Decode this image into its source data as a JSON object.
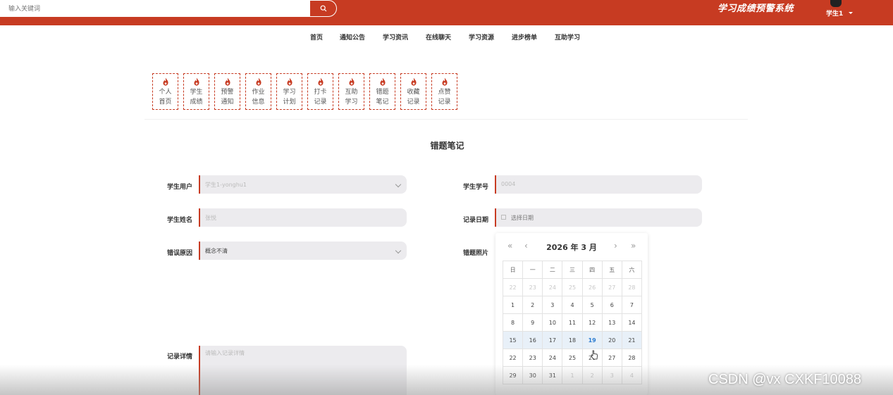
{
  "search": {
    "placeholder": "输入关键词"
  },
  "site_title": "学习成绩预警系统",
  "user": {
    "name": "学生1"
  },
  "nav": [
    "首页",
    "通知公告",
    "学习资讯",
    "在线聊天",
    "学习资源",
    "进步榜单",
    "互助学习"
  ],
  "tiles": [
    [
      "个人",
      "首页"
    ],
    [
      "学生",
      "成绩"
    ],
    [
      "预警",
      "通知"
    ],
    [
      "作业",
      "信息"
    ],
    [
      "学习",
      "计划"
    ],
    [
      "打卡",
      "记录"
    ],
    [
      "互助",
      "学习"
    ],
    [
      "错题",
      "笔记"
    ],
    [
      "收藏",
      "记录"
    ],
    [
      "点赞",
      "记录"
    ]
  ],
  "page_title": "错题笔记",
  "form": {
    "student_user": {
      "label": "学生用户",
      "value": "学生1-yonghu1"
    },
    "student_no": {
      "label": "学生学号",
      "value": "0004"
    },
    "student_name": {
      "label": "学生姓名",
      "value": "张悦"
    },
    "record_date": {
      "label": "记录日期",
      "placeholder": "选择日期"
    },
    "error_reason": {
      "label": "错误原因",
      "value": "概念不清"
    },
    "error_photo": {
      "label": "错题照片"
    },
    "record_detail": {
      "label": "记录详情",
      "placeholder": "请输入记录详情"
    }
  },
  "calendar": {
    "year_label": "2026 年",
    "month_label": "3 月",
    "prev_year": "«",
    "prev_month": "‹",
    "next_month": "›",
    "next_year": "»",
    "weekdays": [
      "日",
      "一",
      "二",
      "三",
      "四",
      "五",
      "六"
    ],
    "weeks": [
      [
        "22",
        "23",
        "24",
        "25",
        "26",
        "27",
        "28"
      ],
      [
        "1",
        "2",
        "3",
        "4",
        "5",
        "6",
        "7"
      ],
      [
        "8",
        "9",
        "10",
        "11",
        "12",
        "13",
        "14"
      ],
      [
        "15",
        "16",
        "17",
        "18",
        "19",
        "20",
        "21"
      ],
      [
        "22",
        "23",
        "24",
        "25",
        "26",
        "27",
        "28"
      ],
      [
        "29",
        "30",
        "31",
        "1",
        "2",
        "3",
        "4"
      ]
    ],
    "selected_day": "19"
  },
  "watermark": "CSDN @vx   CXKF10088",
  "colors": {
    "brand": "#c73b22",
    "field_bg": "#ecebee",
    "selected": "#2b7bd0"
  }
}
